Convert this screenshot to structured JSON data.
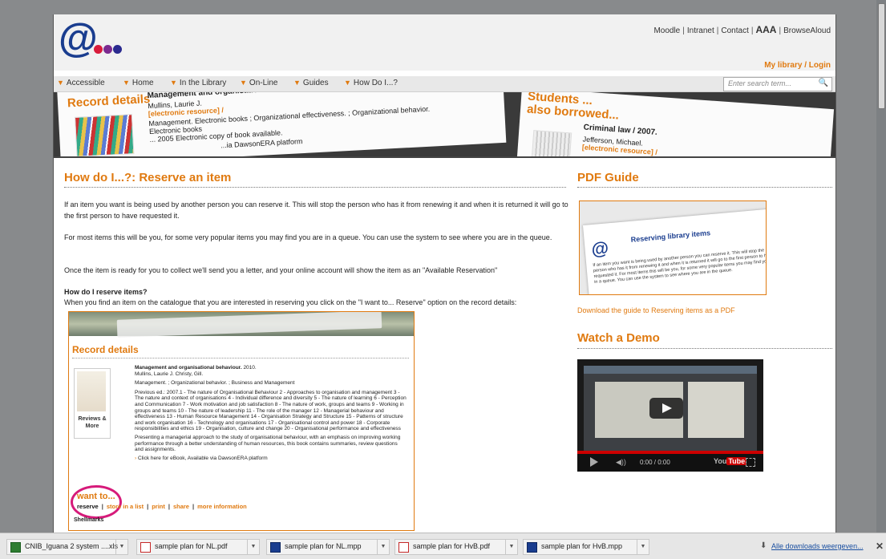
{
  "header": {
    "util_links": [
      "Moodle",
      "Intranet",
      "Contact",
      "AAA",
      "BrowseAloud"
    ],
    "my_library": "My library / Login",
    "logo_dot_colors": [
      "#d81b3b",
      "#7b2a8f",
      "#2a2a8f"
    ]
  },
  "nav": {
    "items": [
      "Accessible",
      "Home",
      "In the Library",
      "On-Line",
      "Guides",
      "How Do I...?"
    ],
    "search_placeholder": "Enter search term..."
  },
  "banner": {
    "record_title": "Record details",
    "record_line1": "Management and organisational behav...",
    "record_line2": "Mullins, Laurie J.",
    "record_line3": "[electronic resource] /",
    "record_line4": "Management. Electronic books ; Organizational effectiveness. ; Organizational behavior.",
    "record_line5": "Electronic books",
    "record_line6": "... 2005 Electronic copy of book available.",
    "record_line7": "...ia DawsonERA platform",
    "students_title": "Students ...",
    "also_borrowed": "also borrowed...",
    "crim_line1": "Criminal law / 2007.",
    "crim_line2": "Jefferson, Michael.",
    "crim_line3": "[electronic resource] /"
  },
  "main": {
    "heading": "How do I...?: Reserve an item",
    "para1": "If an item you want is being used by another person you can reserve it.  This will stop the person who has it from renewing it and when it is returned it will go to the first person to have requested it.",
    "para2": "For most items this will be you, for some very popular items you may find you are in a queue.  You can use the system to see where you are in the queue.",
    "para3": "Once the item is ready for you to collect we'll send you a letter, and your online account will show the item as an \"Available Reservation\"",
    "subheading": "How do I reserve items?",
    "para4": "When you find an item on the catalogue that you are interested in reserving you click on the \"I want to... Reserve\" option on the record details:"
  },
  "record_screenshot": {
    "title": "Record details",
    "cover_caption": "Reviews & More",
    "book_title": "Management and organisational behaviour.",
    "book_year": " 2010.",
    "authors": "Mullins, Laurie J. Christy, Gill.",
    "subjects": "Management. ; Organizational behavior. ; Business and Management",
    "contents": "Previous ed.: 2007.1 - The nature of Organisational Behaviour 2 - Approaches to organisation and management 3 - The nature and context of organisations 4 - Individual difference and diversity 5 - The nature of learning 6 - Perception and Communication 7 - Work motivation and job satisfaction 8 - The nature of work, groups and teams 9 - Working in groups and teams 10 - The nature of leadership 11 - The role of the manager 12 - Managerial behaviour and effectiveness 13 - Human Resource Management 14 - Organisation Strategy and Structure 15 - Patterns of structure and work organisation 16 - Technology and organisations 17 - Organisational control and power 18 - Corporate responsibilities and ethics 19 - Organisation, culture and change 20 - Organisational performance and effectiveness",
    "summary": "Presenting a managerial approach to the study of organisational behaviour, with an emphasis on improving working performance through a better understanding of human resources, this book contains summaries, review questions and assignments.",
    "ebook_link": "Click here for eBook, Available via DawsonERA platform",
    "want_to": "want to...",
    "actions": [
      "reserve",
      "store in a list",
      "print",
      "share",
      "more information"
    ],
    "shelfmarks": "Shellmarks"
  },
  "sidebar": {
    "pdf_heading": "PDF Guide",
    "pdf_page_title": "Reserving library items",
    "pdf_page_text": "If an item you want is being used by another person you can reserve it. This will stop the person who has it from renewing it and when it is returned it will go to the first person to have requested it. For most items this will be you, for some very popular items you may find you are in a queue. You can use the system to see where you are in the queue.",
    "pdf_link": "Download the guide to Reserving items as a PDF",
    "demo_heading": "Watch a Demo",
    "video_time": "0:00 / 0:00",
    "video_brand": "You",
    "video_brand2": "Tube"
  },
  "downloads": {
    "items": [
      "CNIB_Iguana 2 system ....xls",
      "sample plan for NL.pdf",
      "sample plan for NL.mpp",
      "sample plan for HvB.pdf",
      "sample plan for HvB.mpp"
    ],
    "all_label": "Alle downloads weergeven..."
  }
}
